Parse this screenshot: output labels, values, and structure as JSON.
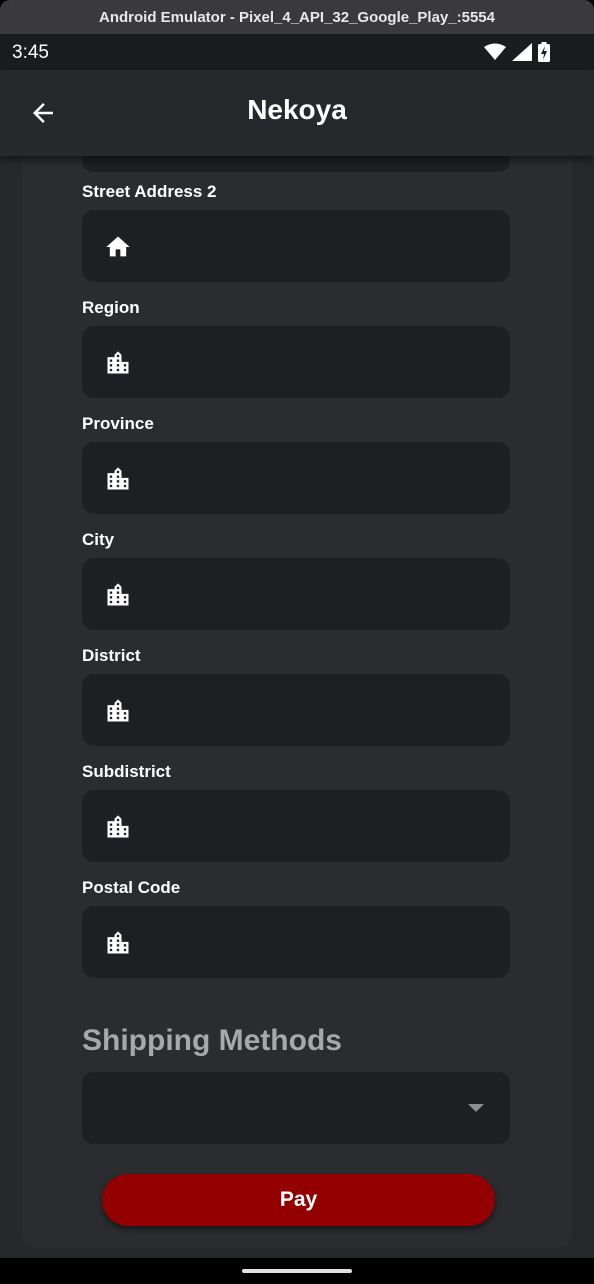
{
  "window": {
    "title": "Android Emulator - Pixel_4_API_32_Google_Play_:5554"
  },
  "status_bar": {
    "time": "3:45"
  },
  "app_bar": {
    "title": "Nekoya"
  },
  "form": {
    "fields": [
      {
        "label": "Street Address 2",
        "icon": "home-icon",
        "value": ""
      },
      {
        "label": "Region",
        "icon": "city-icon",
        "value": ""
      },
      {
        "label": "Province",
        "icon": "city-icon",
        "value": ""
      },
      {
        "label": "City",
        "icon": "city-icon",
        "value": ""
      },
      {
        "label": "District",
        "icon": "city-icon",
        "value": ""
      },
      {
        "label": "Subdistrict",
        "icon": "city-icon",
        "value": ""
      },
      {
        "label": "Postal Code",
        "icon": "city-icon",
        "value": ""
      }
    ]
  },
  "shipping": {
    "title": "Shipping Methods",
    "selected": ""
  },
  "pay_button": {
    "label": "Pay"
  },
  "colors": {
    "background": "#26282c",
    "field": "#1e1f22",
    "pay_button": "#930000",
    "text": "#ffffff",
    "section_title": "#a7a8ab"
  }
}
